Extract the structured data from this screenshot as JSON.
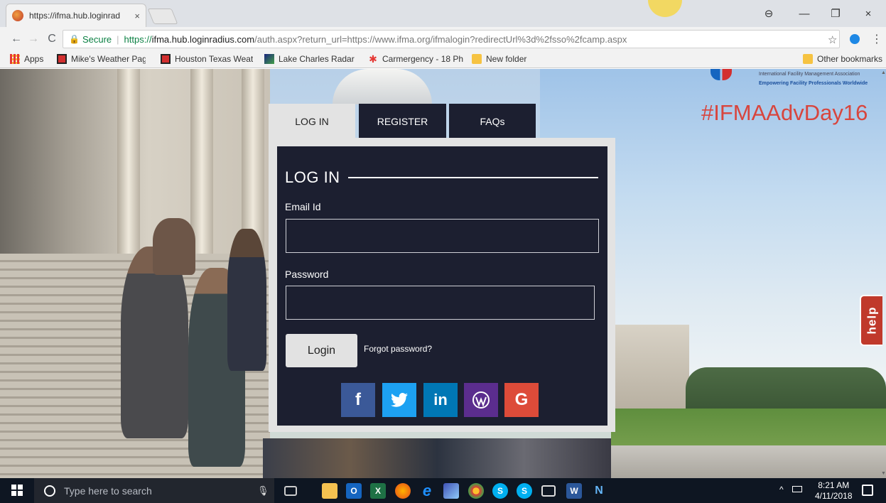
{
  "browser": {
    "tab_title": "https://ifma.hub.loginrad",
    "tab_close": "×",
    "window_controls": {
      "profile": "⊖",
      "minimize": "—",
      "restore": "❐",
      "close": "×"
    },
    "nav": {
      "back": "←",
      "forward": "→",
      "reload": "C"
    },
    "address": {
      "secure_label": "Secure",
      "url_proto": "https://",
      "url_host": "ifma.hub.loginradius.com",
      "url_rest": "/auth.aspx?return_url=https://www.ifma.org/ifmalogin?redirectUrl%3d%2fsso%2fcamp.aspx"
    },
    "bookmarks": [
      {
        "label": "Apps",
        "icon": "apps-icon"
      },
      {
        "label": "Mike's Weather Page",
        "icon": "weather-icon"
      },
      {
        "label": "Houston Texas Weath",
        "icon": "weather-icon"
      },
      {
        "label": "Lake Charles Radar | \\",
        "icon": "radar-icon"
      },
      {
        "label": "Carmergency - 18 Ph",
        "icon": "carmergency-icon"
      },
      {
        "label": "New folder",
        "icon": "folder-icon"
      }
    ],
    "other_bookmarks": "Other bookmarks"
  },
  "page": {
    "org_name": "International Facility Management Association",
    "org_tagline": "Empowering Facility Professionals Worldwide",
    "hashtag": "#IFMAAdvDay16",
    "help_label": "help",
    "tabs": [
      {
        "label": "LOG IN",
        "active": true
      },
      {
        "label": "REGISTER",
        "active": false
      },
      {
        "label": "FAQs",
        "active": false
      }
    ],
    "login": {
      "title": "LOG IN",
      "email_label": "Email Id",
      "email_value": "",
      "password_label": "Password",
      "password_value": "",
      "login_button": "Login",
      "forgot_link": "Forgot password?"
    },
    "social": [
      {
        "name": "facebook",
        "glyph": "f",
        "color": "#3b5998"
      },
      {
        "name": "twitter",
        "glyph": "🐦",
        "color": "#1da1f2"
      },
      {
        "name": "linkedin",
        "glyph": "in",
        "color": "#0077b5"
      },
      {
        "name": "wordpress",
        "glyph": "֍",
        "color": "#5b2d8e"
      },
      {
        "name": "google",
        "glyph": "G",
        "color": "#dd4b39"
      }
    ]
  },
  "taskbar": {
    "search_placeholder": "Type here to search",
    "time": "8:21 AM",
    "date": "4/11/2018"
  }
}
